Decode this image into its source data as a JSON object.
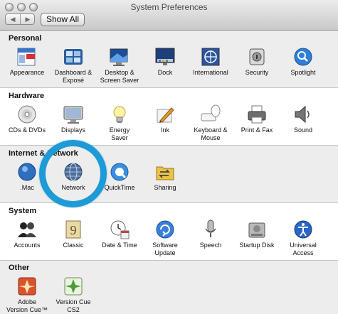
{
  "window": {
    "title": "System Preferences"
  },
  "toolbar": {
    "back_label": "◀",
    "forward_label": "▶",
    "show_all_label": "Show All"
  },
  "sections": [
    {
      "id": "personal",
      "title": "Personal",
      "items": [
        {
          "label": "Appearance",
          "icon": "appearance-icon"
        },
        {
          "label": "Dashboard &\nExposé",
          "icon": "dashboard-expose-icon"
        },
        {
          "label": "Desktop &\nScreen Saver",
          "icon": "desktop-screensaver-icon"
        },
        {
          "label": "Dock",
          "icon": "dock-icon"
        },
        {
          "label": "International",
          "icon": "international-icon"
        },
        {
          "label": "Security",
          "icon": "security-icon"
        },
        {
          "label": "Spotlight",
          "icon": "spotlight-icon"
        }
      ]
    },
    {
      "id": "hardware",
      "title": "Hardware",
      "items": [
        {
          "label": "CDs & DVDs",
          "icon": "cds-dvds-icon"
        },
        {
          "label": "Displays",
          "icon": "displays-icon"
        },
        {
          "label": "Energy\nSaver",
          "icon": "energy-saver-icon"
        },
        {
          "label": "Ink",
          "icon": "ink-icon"
        },
        {
          "label": "Keyboard &\nMouse",
          "icon": "keyboard-mouse-icon"
        },
        {
          "label": "Print & Fax",
          "icon": "print-fax-icon"
        },
        {
          "label": "Sound",
          "icon": "sound-icon"
        }
      ]
    },
    {
      "id": "internet",
      "title": "Internet & Network",
      "items": [
        {
          "label": ".Mac",
          "icon": "dotmac-icon"
        },
        {
          "label": "Network",
          "icon": "network-icon"
        },
        {
          "label": "QuickTime",
          "icon": "quicktime-icon"
        },
        {
          "label": "Sharing",
          "icon": "sharing-icon"
        }
      ]
    },
    {
      "id": "system",
      "title": "System",
      "items": [
        {
          "label": "Accounts",
          "icon": "accounts-icon"
        },
        {
          "label": "Classic",
          "icon": "classic-icon"
        },
        {
          "label": "Date & Time",
          "icon": "date-time-icon"
        },
        {
          "label": "Software\nUpdate",
          "icon": "software-update-icon"
        },
        {
          "label": "Speech",
          "icon": "speech-icon"
        },
        {
          "label": "Startup Disk",
          "icon": "startup-disk-icon"
        },
        {
          "label": "Universal\nAccess",
          "icon": "universal-access-icon"
        }
      ]
    },
    {
      "id": "other",
      "title": "Other",
      "items": [
        {
          "label": "Adobe\nVersion Cue™",
          "icon": "adobe-version-cue-icon"
        },
        {
          "label": "Version Cue\nCS2",
          "icon": "version-cue-cs2-icon"
        }
      ]
    }
  ],
  "highlight": {
    "target": "Network",
    "color": "#1e9ad6"
  }
}
